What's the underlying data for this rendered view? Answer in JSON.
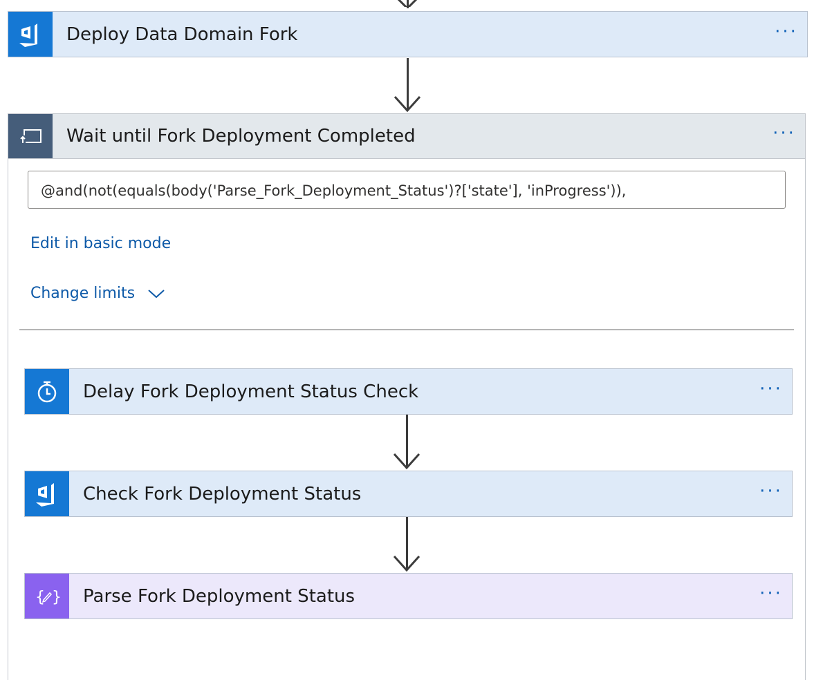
{
  "steps": {
    "deploy": {
      "title": "Deploy Data Domain Fork",
      "icon": "azure-devops-icon",
      "more": "···"
    },
    "wait": {
      "title": "Wait until Fork Deployment Completed",
      "icon": "do-until-icon",
      "more": "···",
      "expression": "@and(not(equals(body('Parse_Fork_Deployment_Status')?['state'], 'inProgress')),",
      "edit_link": "Edit in basic mode",
      "limits_link": "Change limits"
    },
    "delay": {
      "title": "Delay Fork Deployment Status Check",
      "icon": "timer-icon",
      "more": "···"
    },
    "check": {
      "title": "Check Fork Deployment Status",
      "icon": "azure-devops-icon",
      "more": "···"
    },
    "parse": {
      "title": "Parse Fork Deployment Status",
      "icon": "parse-json-icon",
      "more": "···"
    }
  },
  "colors": {
    "devops_blue": "#1578d4",
    "card_blue_bg": "#deeaf8",
    "control_gray": "#455d7a",
    "parse_purple": "#8a62ef",
    "link_blue": "#0e5aa8"
  }
}
